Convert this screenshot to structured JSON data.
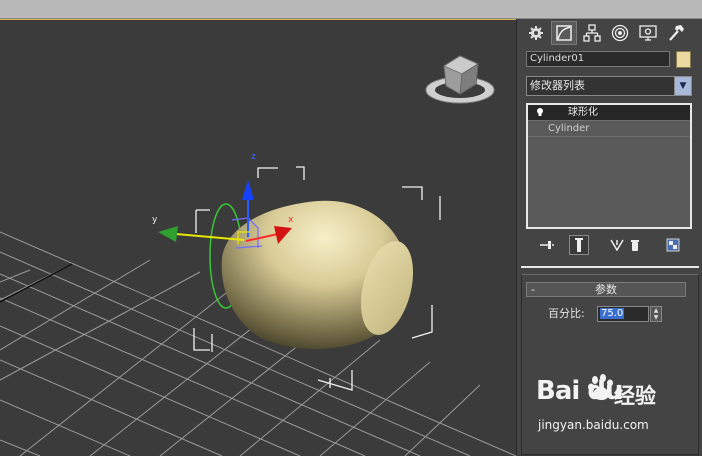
{
  "viewport": {
    "axis_labels": {
      "x": "x",
      "y": "y",
      "z": "z"
    }
  },
  "panel": {
    "tabs": [
      "create-tab",
      "modify-tab",
      "hierarchy-tab",
      "motion-tab",
      "display-tab",
      "utilities-tab"
    ],
    "object_name": "Cylinder01",
    "object_color": "#ead9a0",
    "modifier_list": "修改器列表",
    "stack": [
      {
        "label": "球形化",
        "selected": true
      },
      {
        "label": "Cylinder",
        "selected": false
      }
    ],
    "rollout": {
      "collapse": "-",
      "title": "参数",
      "param_label": "百分比:",
      "param_value": "75.0"
    }
  },
  "watermark": {
    "logo": "Bai du",
    "site_cn": "经验",
    "url": "jingyan.baidu.com"
  }
}
